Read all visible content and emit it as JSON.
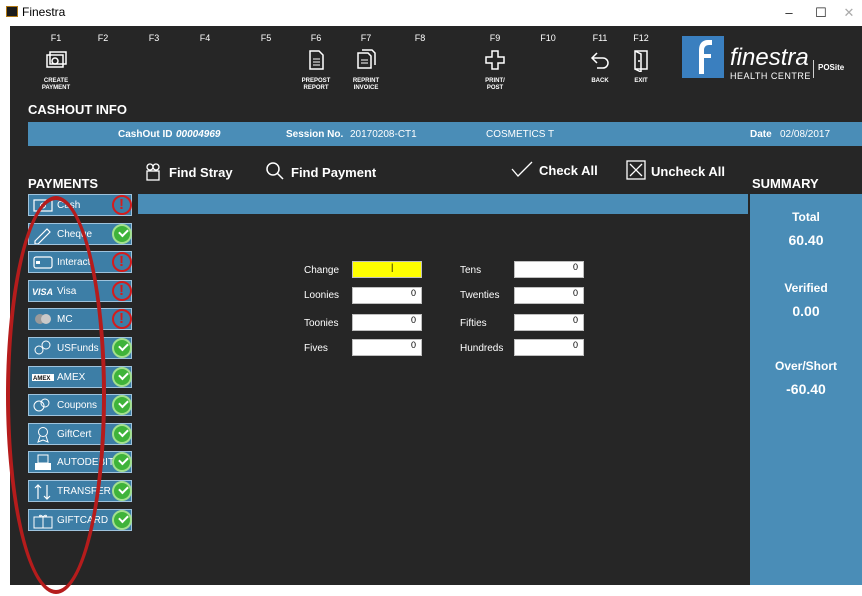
{
  "window": {
    "title": "Finestra",
    "controls": [
      "–",
      "☐",
      "✕"
    ]
  },
  "fkeys": [
    {
      "key": "F1",
      "caption": "CREATE\nPAYMENT",
      "icon": "create-payment-icon"
    },
    {
      "key": "F2",
      "caption": "",
      "icon": ""
    },
    {
      "key": "F3",
      "caption": "",
      "icon": ""
    },
    {
      "key": "F4",
      "caption": "",
      "icon": ""
    },
    {
      "key": "F5",
      "caption": "",
      "icon": ""
    },
    {
      "key": "F6",
      "caption": "PREPOST\nREPORT",
      "icon": "report-icon"
    },
    {
      "key": "F7",
      "caption": "REPRINT\nINVOICE",
      "icon": "invoice-icon"
    },
    {
      "key": "F8",
      "caption": "",
      "icon": ""
    },
    {
      "key": "F9",
      "caption": "PRINT/\nPOST",
      "icon": "print-post-icon"
    },
    {
      "key": "F10",
      "caption": "",
      "icon": ""
    },
    {
      "key": "F11",
      "caption": "BACK",
      "icon": "back-icon"
    },
    {
      "key": "F12",
      "caption": "EXIT",
      "icon": "exit-icon"
    }
  ],
  "logo": {
    "name": "finestra",
    "subtitle": "HEALTH CENTRE",
    "by": "POSite"
  },
  "section_title": "CASHOUT INFO",
  "info": {
    "cashout_label": "CashOut ID",
    "cashout_id": "00004969",
    "session_label": "Session No.",
    "session_no": "20170208-CT1",
    "store": "COSMETICS T",
    "date_label": "Date",
    "date": "02/08/2017"
  },
  "actions": {
    "find_stray": "Find Stray",
    "find_payment": "Find Payment",
    "check_all": "Check All",
    "uncheck_all": "Uncheck All"
  },
  "payments_title": "PAYMENTS",
  "summary_title": "SUMMARY",
  "payments": [
    {
      "label": "Cash",
      "status": "error",
      "icon": "cash-icon"
    },
    {
      "label": "Cheque",
      "status": "ok",
      "icon": "cheque-icon"
    },
    {
      "label": "Interact",
      "status": "error",
      "icon": "card-icon"
    },
    {
      "label": "Visa",
      "status": "error",
      "icon": "visa-icon"
    },
    {
      "label": "MC",
      "status": "error",
      "icon": "mastercard-icon"
    },
    {
      "label": "USFunds",
      "status": "ok",
      "icon": "usfunds-icon"
    },
    {
      "label": "AMEX",
      "status": "ok",
      "icon": "amex-icon"
    },
    {
      "label": "Coupons",
      "status": "ok",
      "icon": "coupons-icon"
    },
    {
      "label": "GiftCert",
      "status": "ok",
      "icon": "giftcert-icon"
    },
    {
      "label": "AUTODEBIT",
      "status": "ok",
      "icon": "autodebit-icon"
    },
    {
      "label": "TRANSFER",
      "status": "ok",
      "icon": "transfer-icon"
    },
    {
      "label": "GIFTCARD",
      "status": "ok",
      "icon": "giftcard-icon"
    }
  ],
  "denominations": {
    "left": [
      {
        "label": "Change",
        "value": "|"
      },
      {
        "label": "Loonies",
        "value": "0"
      },
      {
        "label": "Toonies",
        "value": "0"
      },
      {
        "label": "Fives",
        "value": "0"
      }
    ],
    "right": [
      {
        "label": "Tens",
        "value": "0"
      },
      {
        "label": "Twenties",
        "value": "0"
      },
      {
        "label": "Fifties",
        "value": "0"
      },
      {
        "label": "Hundreds",
        "value": "0"
      }
    ]
  },
  "summary": {
    "total_label": "Total",
    "total": "60.40",
    "verified_label": "Verified",
    "verified": "0.00",
    "overshort_label": "Over/Short",
    "overshort": "-60.40"
  },
  "colors": {
    "accent": "#4a8db7",
    "background": "#262626",
    "ok": "#3fb33a",
    "error": "#d41c1c",
    "annotation": "#b51c1c"
  }
}
